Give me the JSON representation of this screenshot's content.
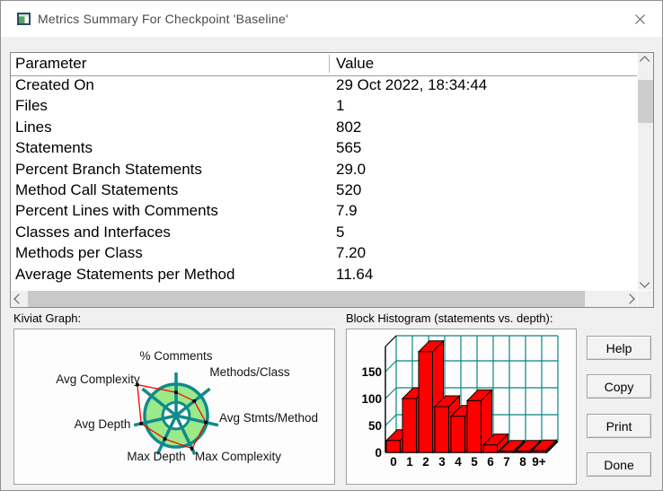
{
  "window": {
    "title": "Metrics Summary For Checkpoint 'Baseline'"
  },
  "table": {
    "columns": [
      "Parameter",
      "Value"
    ],
    "rows": [
      [
        "Created On",
        "29 Oct 2022, 18:34:44"
      ],
      [
        "Files",
        "1"
      ],
      [
        "Lines",
        "802"
      ],
      [
        "Statements",
        "565"
      ],
      [
        "Percent Branch Statements",
        "29.0"
      ],
      [
        "Method Call Statements",
        "520"
      ],
      [
        "Percent Lines with Comments",
        "7.9"
      ],
      [
        "Classes and Interfaces",
        "5"
      ],
      [
        "Methods per Class",
        "7.20"
      ],
      [
        "Average Statements per Method",
        "11.64"
      ]
    ]
  },
  "sections": {
    "kiviat_label": "Kiviat Graph:",
    "histogram_label": "Block Histogram (statements vs. depth):"
  },
  "buttons": [
    {
      "label": "Help"
    },
    {
      "label": "Copy"
    },
    {
      "label": "Print"
    },
    {
      "label": "Done"
    }
  ],
  "colors": {
    "teal": "#118a8a",
    "band_green": "#9ce98a",
    "series_red": "#ff0000",
    "marker_black": "#000000",
    "grid_teal": "#0e8484"
  },
  "chart_data": [
    {
      "type": "radar",
      "title": "Kiviat Graph",
      "axes": [
        "% Comments",
        "Methods/Class",
        "Avg Stmts/Method",
        "Max Complexity",
        "Max Depth",
        "Avg Depth",
        "Avg Complexity"
      ],
      "values_norm": [
        0.54,
        0.54,
        0.71,
        0.85,
        0.6,
        0.83,
        1.15
      ],
      "band_norm": {
        "inner": 0.31,
        "outer": 0.73
      },
      "legend": "none"
    },
    {
      "type": "bar",
      "title": "Block Histogram (statements vs. depth)",
      "categories": [
        "0",
        "1",
        "2",
        "3",
        "4",
        "5",
        "6",
        "7",
        "8",
        "9+"
      ],
      "values": [
        22,
        100,
        187,
        85,
        67,
        96,
        14,
        2,
        2,
        3
      ],
      "xlabel": "depth",
      "ylabel": "statements",
      "yticks": [
        0,
        50,
        100,
        150
      ],
      "ylim": [
        0,
        195
      ],
      "grid": true,
      "style": {
        "effect": "3d",
        "bar_color": "#ff0000",
        "outline": "#000000"
      }
    }
  ]
}
